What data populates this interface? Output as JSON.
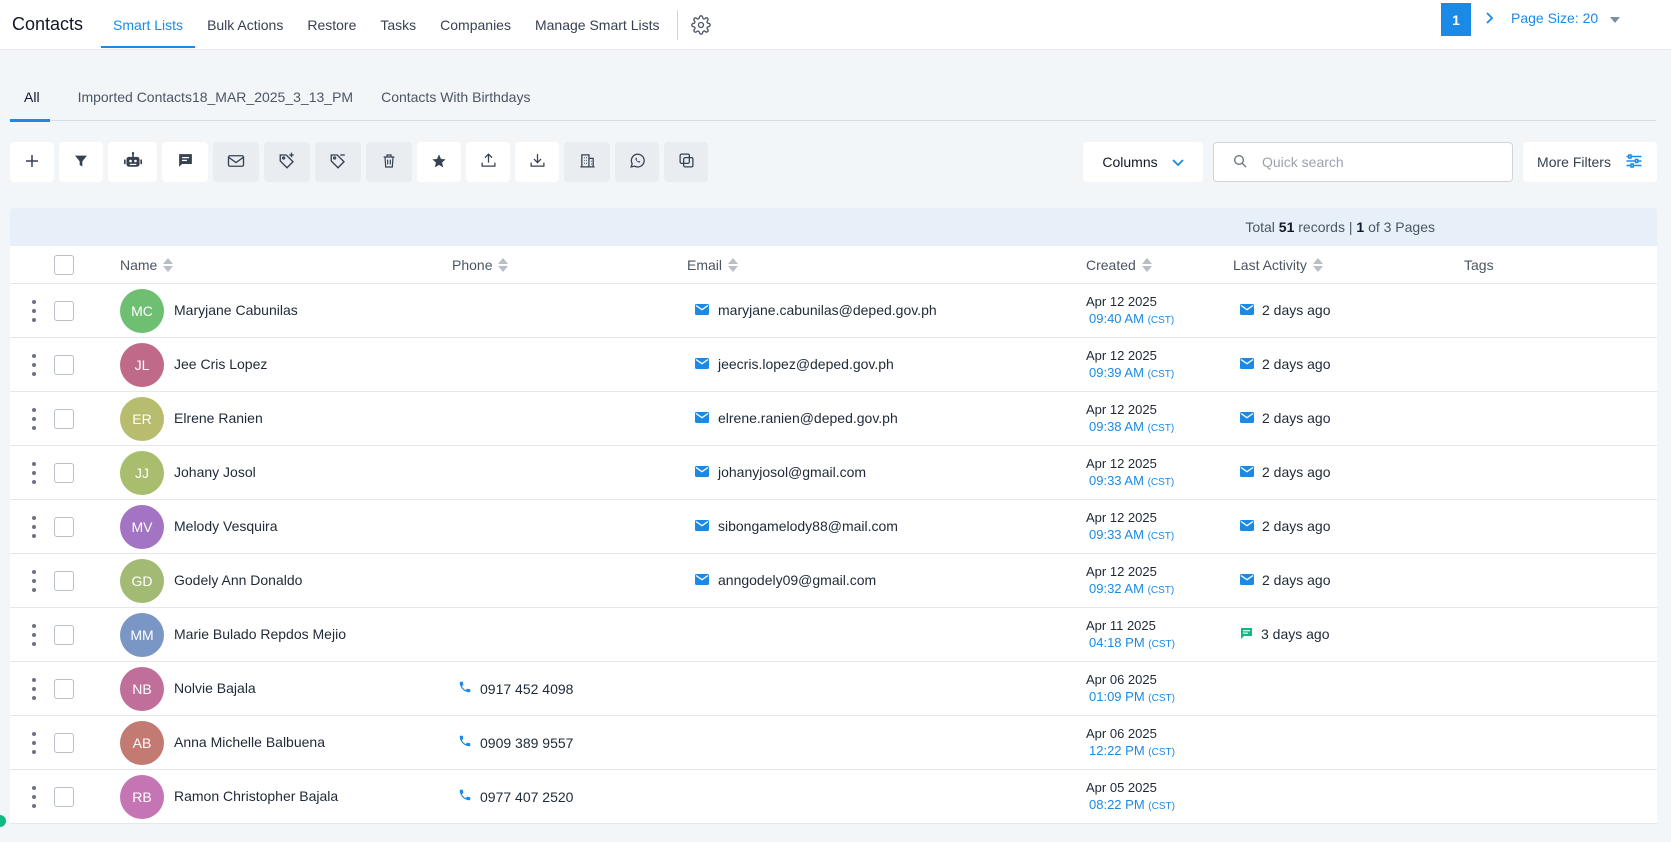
{
  "app": {
    "title": "Contacts",
    "nav_tabs": [
      "Smart Lists",
      "Bulk Actions",
      "Restore",
      "Tasks",
      "Companies",
      "Manage Smart Lists"
    ]
  },
  "sub_tabs": [
    "All",
    "Imported Contacts18_MAR_2025_3_13_PM",
    "Contacts With Birthdays"
  ],
  "toolbar": {
    "icons": [
      "plus-icon",
      "filter-icon",
      "robot-icon",
      "chat-icon",
      "mail-icon",
      "add-tag-icon",
      "remove-tag-icon",
      "trash-icon",
      "star-icon",
      "export-icon",
      "import-icon",
      "building-icon",
      "whatsapp-icon",
      "duplicate-icon"
    ],
    "columns_label": "Columns",
    "search_placeholder": "Quick search",
    "more_filters_label": "More Filters"
  },
  "pagination": {
    "total_prefix": "Total",
    "total_records": "51",
    "records_label": "records |",
    "page": "1",
    "of_label": "of 3 Pages",
    "current_page": "1",
    "page_size_label": "Page Size: 20"
  },
  "columns": [
    "Name",
    "Phone",
    "Email",
    "Created",
    "Last Activity",
    "Tags"
  ],
  "rows": [
    {
      "initials": "MC",
      "color": "#6fbf73",
      "name": "Maryjane Cabunilas",
      "phone": "",
      "email": "maryjane.cabunilas@deped.gov.ph",
      "date": "Apr 12 2025",
      "time": "09:40 AM",
      "tz": "(CST)",
      "activity_type": "email",
      "activity": "2 days ago"
    },
    {
      "initials": "JL",
      "color": "#c06a8a",
      "name": "Jee Cris Lopez",
      "phone": "",
      "email": "jeecris.lopez@deped.gov.ph",
      "date": "Apr 12 2025",
      "time": "09:39 AM",
      "tz": "(CST)",
      "activity_type": "email",
      "activity": "2 days ago"
    },
    {
      "initials": "ER",
      "color": "#b8bc6e",
      "name": "Elrene Ranien",
      "phone": "",
      "email": "elrene.ranien@deped.gov.ph",
      "date": "Apr 12 2025",
      "time": "09:38 AM",
      "tz": "(CST)",
      "activity_type": "email",
      "activity": "2 days ago"
    },
    {
      "initials": "JJ",
      "color": "#a9bd6e",
      "name": "Johany Josol",
      "phone": "",
      "email": "johanyjosol@gmail.com",
      "date": "Apr 12 2025",
      "time": "09:33 AM",
      "tz": "(CST)",
      "activity_type": "email",
      "activity": "2 days ago"
    },
    {
      "initials": "MV",
      "color": "#a373c4",
      "name": "Melody Vesquira",
      "phone": "",
      "email": "sibongamelody88@mail.com",
      "date": "Apr 12 2025",
      "time": "09:33 AM",
      "tz": "(CST)",
      "activity_type": "email",
      "activity": "2 days ago"
    },
    {
      "initials": "GD",
      "color": "#a3ba74",
      "name": "Godely Ann Donaldo",
      "phone": "",
      "email": "anngodely09@gmail.com",
      "date": "Apr 12 2025",
      "time": "09:32 AM",
      "tz": "(CST)",
      "activity_type": "email",
      "activity": "2 days ago"
    },
    {
      "initials": "MM",
      "color": "#7a96c4",
      "name": "Marie Bulado Repdos Mejio",
      "phone": "",
      "email": "",
      "date": "Apr 11 2025",
      "time": "04:18 PM",
      "tz": "(CST)",
      "activity_type": "sms",
      "activity": "3 days ago"
    },
    {
      "initials": "NB",
      "color": "#bf6f99",
      "name": "Nolvie Bajala",
      "phone": "0917 452 4098",
      "email": "",
      "date": "Apr 06 2025",
      "time": "01:09 PM",
      "tz": "(CST)",
      "activity_type": "",
      "activity": ""
    },
    {
      "initials": "AB",
      "color": "#c27a72",
      "name": "Anna Michelle Balbuena",
      "phone": "0909 389 9557",
      "email": "",
      "date": "Apr 06 2025",
      "time": "12:22 PM",
      "tz": "(CST)",
      "activity_type": "",
      "activity": ""
    },
    {
      "initials": "RB",
      "color": "#c574b4",
      "name": "Ramon Christopher Bajala",
      "phone": "0977 407 2520",
      "email": "",
      "date": "Apr 05 2025",
      "time": "08:22 PM",
      "tz": "(CST)",
      "activity_type": "",
      "activity": ""
    }
  ],
  "colors": {
    "accent": "#1a8ae6",
    "sms": "#10b981"
  }
}
